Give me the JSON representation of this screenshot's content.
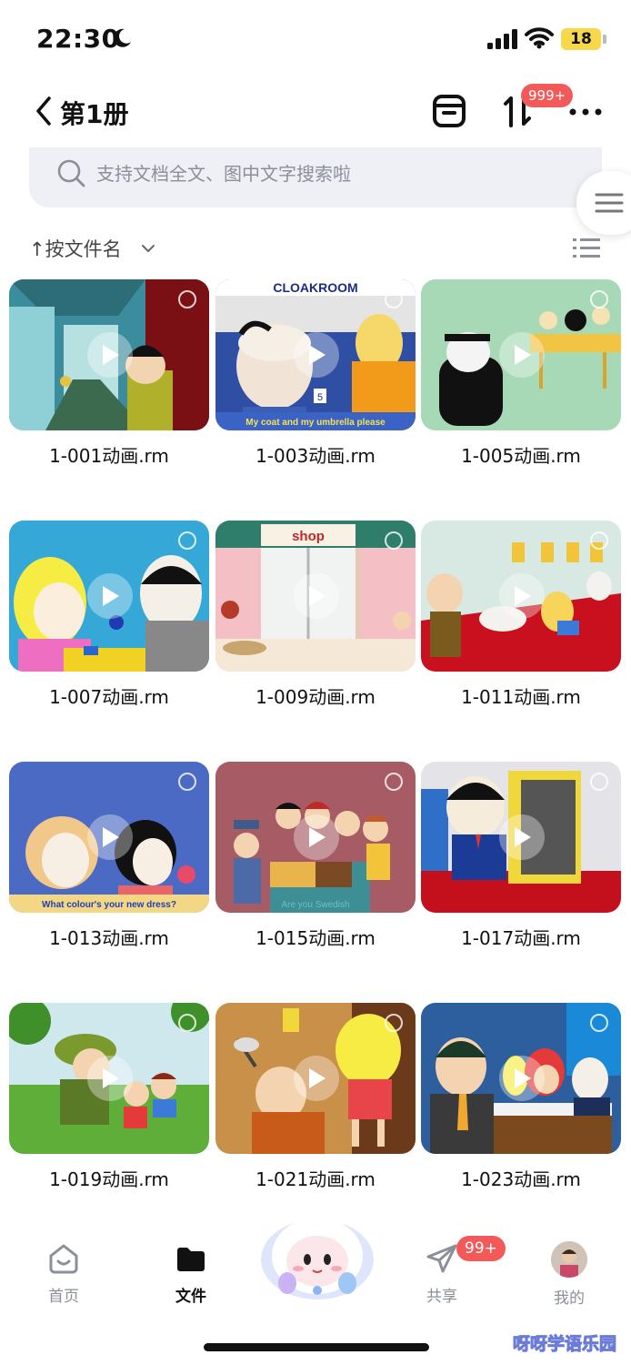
{
  "status_bar": {
    "time": "22:30",
    "battery": "18"
  },
  "nav": {
    "title": "第1册",
    "badge": "999+"
  },
  "search": {
    "placeholder": "支持文档全文、图中文字搜索啦"
  },
  "sort": {
    "label": "↑按文件名"
  },
  "files": [
    {
      "name": "1-001动画.rm",
      "caption": ""
    },
    {
      "name": "1-003动画.rm",
      "caption": "My coat and my umbrella please",
      "sign": "CLOAKROOM",
      "ticket": "5"
    },
    {
      "name": "1-005动画.rm",
      "caption": ""
    },
    {
      "name": "1-007动画.rm",
      "caption": ""
    },
    {
      "name": "1-009动画.rm",
      "caption": "",
      "sign": "shop"
    },
    {
      "name": "1-011动画.rm",
      "caption": ""
    },
    {
      "name": "1-013动画.rm",
      "caption": "What colour's your new dress?"
    },
    {
      "name": "1-015动画.rm",
      "caption": "Are you Swedish"
    },
    {
      "name": "1-017动画.rm",
      "caption": ""
    },
    {
      "name": "1-019动画.rm",
      "caption": ""
    },
    {
      "name": "1-021动画.rm",
      "caption": ""
    },
    {
      "name": "1-023动画.rm",
      "caption": ""
    }
  ],
  "tabs": [
    {
      "label": "首页",
      "icon": "home-icon"
    },
    {
      "label": "文件",
      "icon": "folder-icon",
      "active": true
    },
    {
      "label": "共享",
      "icon": "send-icon",
      "badge": "99+"
    },
    {
      "label": "我的",
      "icon": "avatar"
    }
  ],
  "watermark": "呀呀学语乐园"
}
